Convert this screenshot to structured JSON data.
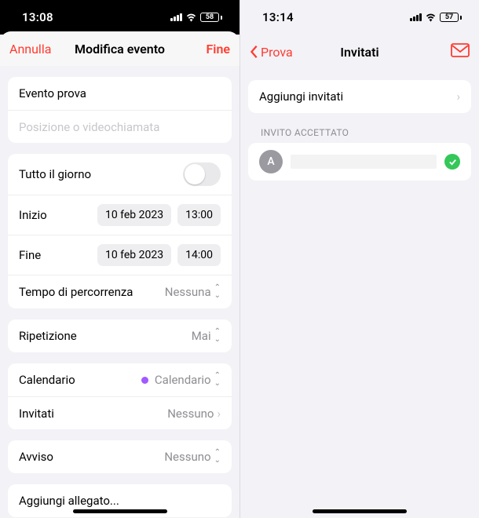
{
  "left": {
    "status": {
      "time": "13:08",
      "battery": "58"
    },
    "nav": {
      "cancel": "Annulla",
      "title": "Modifica evento",
      "done": "Fine"
    },
    "event": {
      "title": "Evento prova",
      "location_placeholder": "Posizione o videochiamata"
    },
    "datetime": {
      "all_day_label": "Tutto il giorno",
      "start_label": "Inizio",
      "start_date": "10 feb 2023",
      "start_time": "13:00",
      "end_label": "Fine",
      "end_date": "10 feb 2023",
      "end_time": "14:00",
      "travel_label": "Tempo di percorrenza",
      "travel_value": "Nessuna"
    },
    "repeat": {
      "label": "Ripetizione",
      "value": "Mai"
    },
    "calendar": {
      "label": "Calendario",
      "value": "Calendario"
    },
    "invitees": {
      "label": "Invitati",
      "value": "Nessuno"
    },
    "alert": {
      "label": "Avviso",
      "value": "Nessuno"
    },
    "attach": {
      "label": "Aggiungi allegato..."
    }
  },
  "right": {
    "status": {
      "time": "13:14",
      "battery": "57"
    },
    "nav": {
      "back": "Prova",
      "title": "Invitati"
    },
    "add": {
      "label": "Aggiungi invitati"
    },
    "section_header": "INVITO ACCETTATO",
    "invitee": {
      "initial": "A"
    }
  }
}
